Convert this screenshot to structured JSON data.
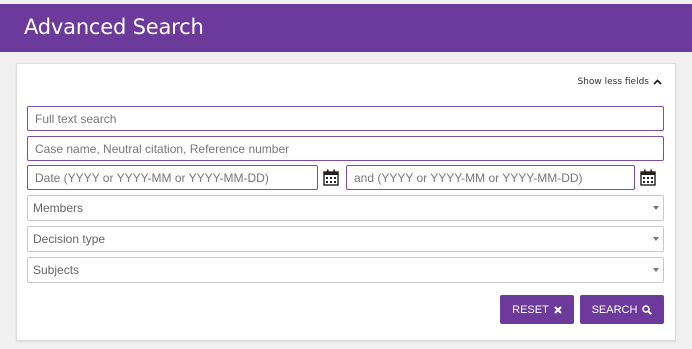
{
  "header": {
    "title": "Advanced Search"
  },
  "panel": {
    "toggle_label": "Show less fields",
    "full_text_placeholder": "Full text search",
    "case_name_placeholder": "Case name, Neutral citation, Reference number",
    "date_from_placeholder": "Date (YYYY or YYYY-MM or YYYY-MM-DD)",
    "date_to_placeholder": "and (YYYY or YYYY-MM or YYYY-MM-DD)",
    "members_label": "Members",
    "decision_type_label": "Decision type",
    "subjects_label": "Subjects",
    "reset_label": "RESET",
    "search_label": "SEARCH"
  },
  "colors": {
    "accent": "#6b3a9b",
    "background": "#f0f0f0"
  },
  "icons": [
    "chevron-up-icon",
    "calendar-icon",
    "close-icon",
    "search-icon",
    "caret-down-icon"
  ]
}
